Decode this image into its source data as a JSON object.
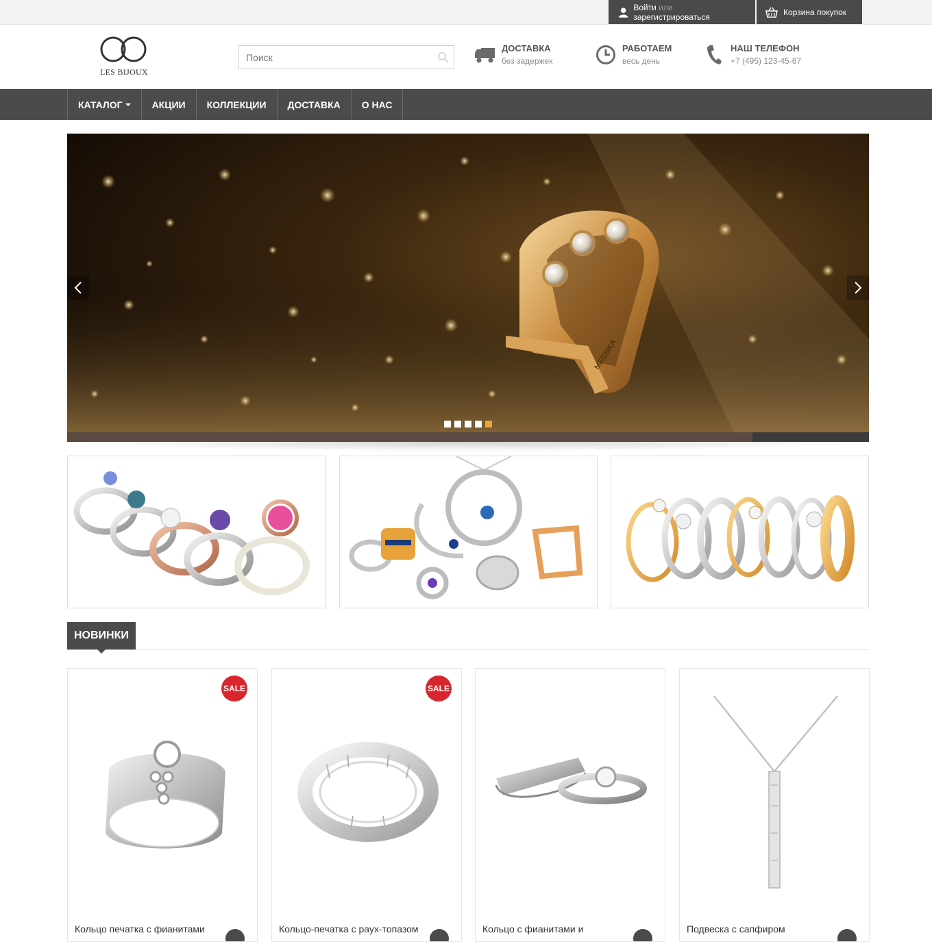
{
  "topbar": {
    "login": "Войти",
    "or": "или",
    "register": "зарегистрироваться",
    "cart": "Корзина покупок"
  },
  "header": {
    "logo_text": "LES BIJOUX",
    "search_placeholder": "Поиск",
    "info": [
      {
        "title": "ДОСТАВКА",
        "subtitle": "без задержек",
        "icon": "truck-icon"
      },
      {
        "title": "РАБОТАЕМ",
        "subtitle": "весь день",
        "icon": "clock-icon"
      },
      {
        "title": "НАШ ТЕЛЕФОН",
        "subtitle": "+7 (495) 123-45-67",
        "icon": "phone-icon"
      }
    ]
  },
  "nav": {
    "items": [
      {
        "label": "КАТАЛОГ"
      },
      {
        "label": "АКЦИИ"
      },
      {
        "label": "КОЛЛЕКЦИИ"
      },
      {
        "label": "ДОСТАВКА"
      },
      {
        "label": "О НАС"
      }
    ]
  },
  "slider": {
    "engraving": "MESSIKA",
    "slide_count": 5,
    "active_slide": 5
  },
  "section": {
    "title": "НОВИНКИ"
  },
  "products": [
    {
      "name": "Кольцо печатка с фианитами",
      "badge": "SALE"
    },
    {
      "name": "Кольцо-печатка с раух-топазом",
      "badge": "SALE"
    },
    {
      "name": "Кольцо с фианитами и",
      "badge": ""
    },
    {
      "name": "Подвеска с сапфиром",
      "badge": ""
    }
  ],
  "colors": {
    "dark": "#4b4b4b",
    "sale": "#d8262f",
    "active_dot": "#f0a23a"
  }
}
